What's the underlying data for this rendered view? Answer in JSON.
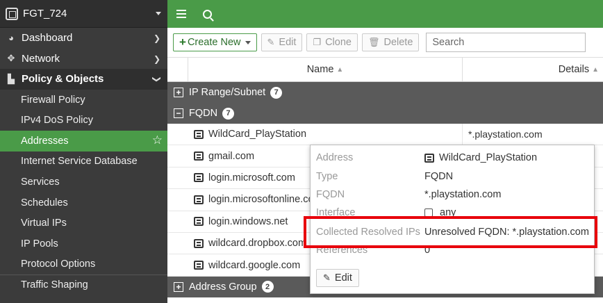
{
  "sidebar": {
    "device_name": "FGT_724",
    "items": [
      {
        "label": "Dashboard"
      },
      {
        "label": "Network"
      },
      {
        "label": "Policy & Objects"
      }
    ],
    "subitems": [
      {
        "label": "Firewall Policy"
      },
      {
        "label": "IPv4 DoS Policy"
      },
      {
        "label": "Addresses"
      },
      {
        "label": "Internet Service Database"
      },
      {
        "label": "Services"
      },
      {
        "label": "Schedules"
      },
      {
        "label": "Virtual IPs"
      },
      {
        "label": "IP Pools"
      },
      {
        "label": "Protocol Options"
      },
      {
        "label": "Traffic Shaping"
      }
    ]
  },
  "toolbar": {
    "create_new": "Create New",
    "edit": "Edit",
    "clone": "Clone",
    "delete": "Delete",
    "search_placeholder": "Search"
  },
  "table": {
    "col_name": "Name",
    "col_details": "Details",
    "groups": [
      {
        "label": "IP Range/Subnet",
        "count": "7"
      },
      {
        "label": "FQDN",
        "count": "7"
      },
      {
        "label": "Address Group",
        "count": "2"
      }
    ],
    "rows": [
      {
        "name": "WildCard_PlayStation",
        "details": "*.playstation.com"
      },
      {
        "name": "gmail.com",
        "details": ""
      },
      {
        "name": "login.microsoft.com",
        "details": ""
      },
      {
        "name": "login.microsoftonline.com",
        "details": ""
      },
      {
        "name": "login.windows.net",
        "details": ""
      },
      {
        "name": "wildcard.dropbox.com",
        "details": ""
      },
      {
        "name": "wildcard.google.com",
        "details": ""
      }
    ]
  },
  "tooltip": {
    "address_label": "Address",
    "address_value": "WildCard_PlayStation",
    "type_label": "Type",
    "type_value": "FQDN",
    "fqdn_label": "FQDN",
    "fqdn_value": "*.playstation.com",
    "interface_label": "Interface",
    "interface_value": "any",
    "resolved_label": "Collected Resolved IPs",
    "resolved_value": "Unresolved FQDN: *.playstation.com",
    "references_label": "References",
    "references_value": "0",
    "edit_label": "Edit"
  },
  "colors": {
    "accent": "#4a9b48",
    "highlight": "#e8000b"
  }
}
